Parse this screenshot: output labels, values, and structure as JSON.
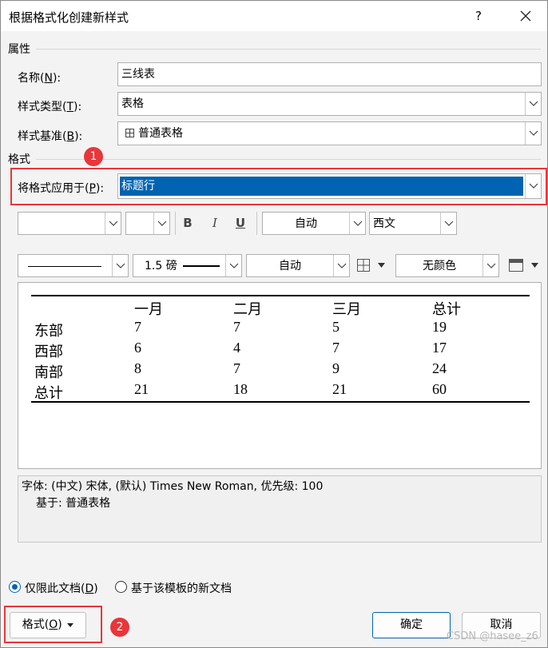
{
  "window": {
    "title": "根据格式化创建新样式",
    "help_label": "?"
  },
  "properties": {
    "section_label": "属性",
    "name_label": "名称",
    "name_key": "N",
    "name_value": "三线表",
    "type_label": "样式类型",
    "type_key": "T",
    "type_value": "表格",
    "base_label": "样式基准",
    "base_key": "B",
    "base_value": "普通表格"
  },
  "format": {
    "section_label": "格式",
    "apply_label": "将格式应用于",
    "apply_key": "P",
    "apply_value": "标题行",
    "font_name": "",
    "font_size": "",
    "bold": "B",
    "italic": "I",
    "underline": "U",
    "font_color": "自动",
    "script": "西文",
    "border_weight": "1.5 磅",
    "border_color": "自动",
    "shading": "无颜色"
  },
  "preview": {
    "columns": [
      "",
      "一月",
      "二月",
      "三月",
      "总计"
    ],
    "rows": [
      {
        "label": "东部",
        "values": [
          "7",
          "7",
          "5",
          "19"
        ]
      },
      {
        "label": "西部",
        "values": [
          "6",
          "4",
          "7",
          "17"
        ]
      },
      {
        "label": "南部",
        "values": [
          "8",
          "7",
          "9",
          "24"
        ]
      },
      {
        "label": "总计",
        "values": [
          "21",
          "18",
          "21",
          "60"
        ]
      }
    ]
  },
  "description": {
    "line1": "字体: (中文) 宋体, (默认) Times New Roman, 优先级: 100",
    "line2": "基于: 普通表格"
  },
  "scope": {
    "this_doc_label": "仅限此文档",
    "this_doc_key": "D",
    "template_label": "基于该模板的新文档",
    "selected": "this_doc"
  },
  "buttons": {
    "format_label": "格式",
    "format_key": "O",
    "ok_label": "确定",
    "cancel_label": "取消"
  },
  "annotations": {
    "badge1": "1",
    "badge2": "2"
  },
  "watermark": "CSDN @hasee_z6",
  "colors": {
    "accent": "#0063b1",
    "annotation_red": "#e8363a"
  }
}
